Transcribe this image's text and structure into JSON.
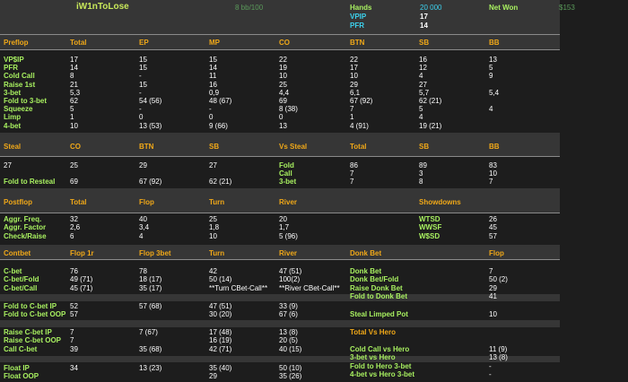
{
  "header": {
    "player": "iW1nToLose",
    "stakes": "8 bb/100",
    "hands_label": "Hands",
    "hands_value": "20 000",
    "vpip_label": "VPIP",
    "vpip_value": "17",
    "pfr_label": "PFR",
    "pfr_value": "14",
    "net_won_label": "Net Won",
    "net_won_value": "$153"
  },
  "preflop": {
    "headers": [
      "Preflop",
      "Total",
      "EP",
      "MP",
      "CO",
      "BTN",
      "SB",
      "BB"
    ],
    "rows": [
      {
        "label": "VP$IP",
        "cells": [
          "17",
          "15",
          "15",
          "22",
          "22",
          "16",
          "13"
        ]
      },
      {
        "label": "PFR",
        "cells": [
          "14",
          "15",
          "14",
          "19",
          "17",
          "12",
          "5"
        ]
      },
      {
        "label": "Cold Call",
        "cells": [
          "8",
          "-",
          "11",
          "10",
          "10",
          "4",
          "9"
        ]
      },
      {
        "label": "Raise 1st",
        "cells": [
          "21",
          "15",
          "16",
          "25",
          "29",
          "27",
          ""
        ]
      },
      {
        "label": "3-bet",
        "cells": [
          "5,3",
          "-",
          "0,9",
          "4,4",
          "6,1",
          "5,7",
          "5,4"
        ]
      },
      {
        "label": "Fold to 3-bet",
        "cells": [
          "62",
          "54 (56)",
          "48 (67)",
          "69",
          "67 (92)",
          "62 (21)",
          ""
        ]
      },
      {
        "label": "Squeeze",
        "cells": [
          "5",
          "-",
          "-",
          "8 (38)",
          "7",
          "5",
          "4"
        ]
      },
      {
        "label": "Limp",
        "cells": [
          "1",
          "0",
          "0",
          "0",
          "1",
          "4",
          ""
        ]
      },
      {
        "label": "4-bet",
        "cells": [
          "10",
          "13 (53)",
          "9 (66)",
          "13",
          "4 (91)",
          "19 (21)",
          ""
        ]
      }
    ]
  },
  "steal": {
    "headers": [
      "Steal",
      "CO",
      "BTN",
      "SB",
      "Vs Steal",
      "Total",
      "SB",
      "BB"
    ],
    "rows": [
      {
        "cells": [
          "27",
          "25",
          "29",
          "27",
          "Fold",
          "86",
          "89",
          "83"
        ]
      },
      {
        "cells": [
          "",
          "",
          "",
          "",
          "Call",
          "7",
          "3",
          "10"
        ]
      },
      {
        "cells": [
          "Fold to Resteal",
          "69",
          "67 (92)",
          "62 (21)",
          "3-bet",
          "7",
          "8",
          "7"
        ]
      }
    ]
  },
  "postflop": {
    "headers": [
      "Postflop",
      "Total",
      "Flop",
      "Turn",
      "River"
    ],
    "rows": [
      {
        "label": "Aggr. Freq.",
        "cells": [
          "32",
          "40",
          "25",
          "20"
        ]
      },
      {
        "label": "Aggr. Factor",
        "cells": [
          "2,6",
          "3,4",
          "1,8",
          "1,7"
        ]
      },
      {
        "label": "Check/Raise",
        "cells": [
          "6",
          "4",
          "10",
          "5 (96)"
        ]
      }
    ],
    "showdowns": {
      "header": "Showdowns",
      "rows": [
        {
          "label": "WTSD",
          "value": "26"
        },
        {
          "label": "WWSF",
          "value": "45"
        },
        {
          "label": "W$SD",
          "value": "57"
        }
      ]
    }
  },
  "contbet": {
    "headers": [
      "Contbet",
      "Flop 1r",
      "Flop 3bet",
      "Turn",
      "River"
    ],
    "group1": [
      {
        "label": "C-bet",
        "cells": [
          "76",
          "78",
          "42",
          "47 (51)"
        ]
      },
      {
        "label": "C-bet/Fold",
        "cells": [
          "49 (71)",
          "18 (17)",
          "50 (14)",
          "100(2)"
        ]
      },
      {
        "label": "C-bet/Call",
        "cells": [
          "45 (71)",
          "35 (17)",
          "**Turn CBet-Call**",
          "**River CBet-Call**"
        ]
      }
    ],
    "group2": [
      {
        "label": "Fold to C-bet IP",
        "cells": [
          "52",
          "57 (68)",
          "47 (51)",
          "33 (9)"
        ]
      },
      {
        "label": "Fold to C-bet OOP",
        "cells": [
          "57",
          "",
          "30 (20)",
          "67 (6)"
        ]
      }
    ],
    "group3": [
      {
        "label": "Raise C-bet IP",
        "cells": [
          "7",
          "7 (67)",
          "17 (48)",
          "13 (8)"
        ]
      },
      {
        "label": "Raise C-bet OOP",
        "cells": [
          "7",
          "",
          "16 (19)",
          "20 (5)"
        ]
      },
      {
        "label": "Call C-bet",
        "cells": [
          "39",
          "35 (68)",
          "42 (71)",
          "40 (15)"
        ]
      }
    ],
    "group4": [
      {
        "label": "Float IP",
        "cells": [
          "34",
          "13 (23)",
          "35 (40)",
          "50 (10)"
        ]
      },
      {
        "label": "Float OOP",
        "cells": [
          "",
          "",
          "29",
          "35 (26)"
        ]
      }
    ]
  },
  "donkbet": {
    "headers": [
      "Donk Bet",
      "Flop"
    ],
    "rows": [
      {
        "label": "Donk Bet",
        "value": "7"
      },
      {
        "label": "Donk Bet/Fold",
        "value": "50 (2)"
      },
      {
        "label": "Raise Donk Bet",
        "value": "29"
      },
      {
        "label": "Fold to Donk Bet",
        "value": "41"
      }
    ],
    "steal_limped": {
      "label": "Steal Limped Pot",
      "value": "10"
    }
  },
  "vshero": {
    "header": "Total Vs Hero",
    "rows": [
      {
        "label": "Cold Call vs Hero",
        "value": "11 (9)"
      },
      {
        "label": "3-bet vs Hero",
        "value": "13 (8)"
      },
      {
        "label": "Fold to Hero 3-bet",
        "value": "-"
      },
      {
        "label": "4-bet vs Hero 3-bet",
        "value": "-"
      }
    ]
  }
}
